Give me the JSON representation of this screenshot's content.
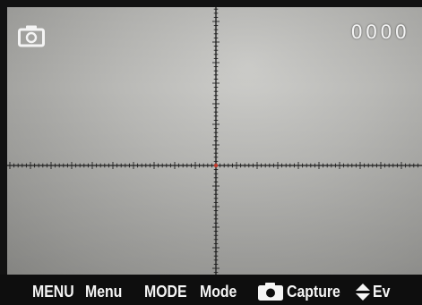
{
  "viewfinder": {
    "mode_icon": "camera-icon",
    "shot_counter": "0000",
    "crosshair_center_color": "#c0392b",
    "reticle_color": "#1e1e1e"
  },
  "bottom_bar": {
    "menu_key": "MENU",
    "menu_label": "Menu",
    "mode_key": "MODE",
    "mode_label": "Mode",
    "capture_icon": "camera-shutter-icon",
    "capture_label": "Capture",
    "ev_icon": "up-down-arrow-icon",
    "ev_label": "Ev"
  }
}
